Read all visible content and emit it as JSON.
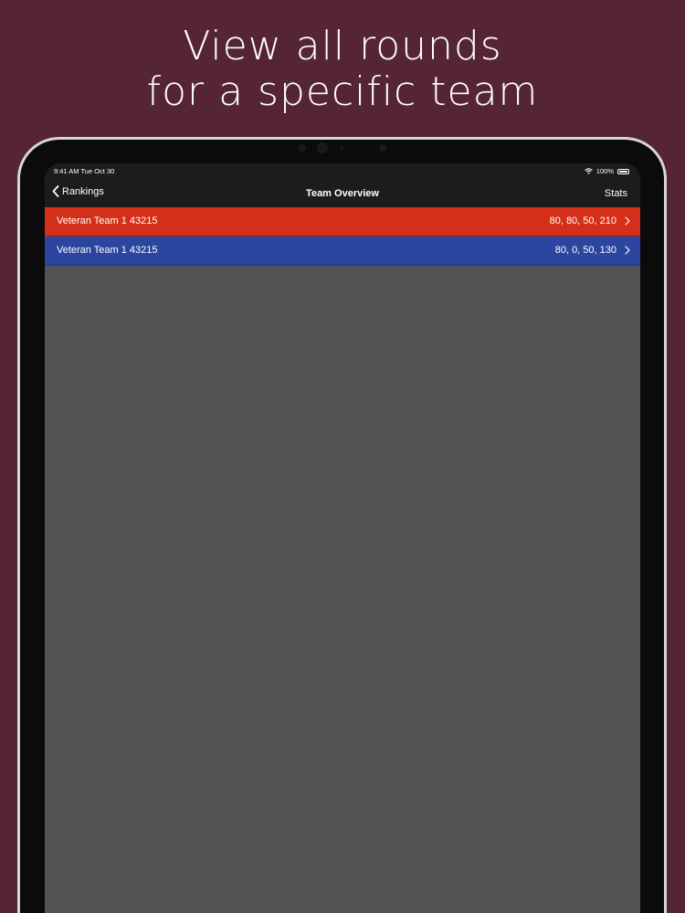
{
  "headline": {
    "line1": "View all rounds",
    "line2": "for a specific team"
  },
  "status_bar": {
    "time": "9:41 AM  Tue Oct 30",
    "battery": "100%"
  },
  "nav_bar": {
    "back_label": "Rankings",
    "title": "Team Overview",
    "right_label": "Stats"
  },
  "rounds": [
    {
      "team": "Veteran Team 1 43215",
      "scores": "80, 80, 50, 210",
      "alliance": "red",
      "color": "#d42f18"
    },
    {
      "team": "Veteran Team 1 43215",
      "scores": "80, 0, 50, 130",
      "alliance": "blue",
      "color": "#2c459e"
    }
  ],
  "colors": {
    "background": "#552437",
    "screen": "#545456",
    "bar": "#1c1c1e"
  }
}
